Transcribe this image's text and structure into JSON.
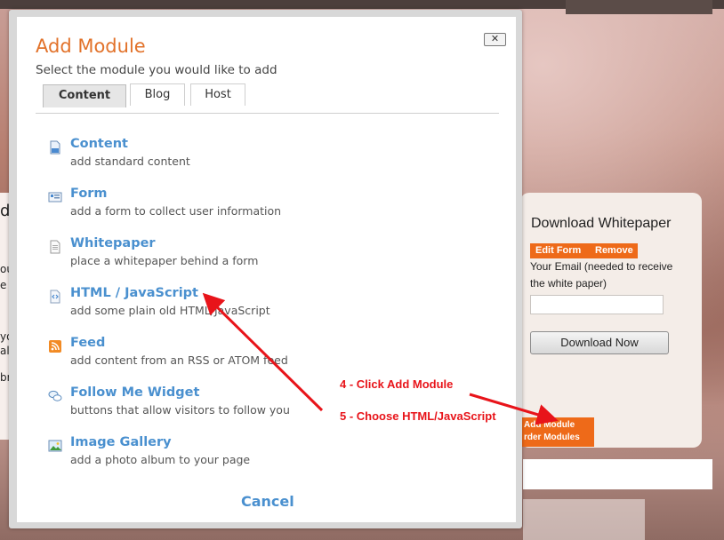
{
  "background": {
    "left_snippets": [
      "d",
      "ou",
      "e",
      "you",
      "allin",
      "br"
    ],
    "widget": {
      "title": "Download Whitepaper",
      "edit_form_label": "Edit Form",
      "remove_label": "Remove",
      "email_label": "Your Email (needed to receive the white paper)",
      "email_value": "",
      "download_button": "Download Now"
    },
    "add_module_button": {
      "line1": "Add Module",
      "line2": "rder Modules"
    },
    "colors": {
      "accent_orange": "#ee6a19"
    }
  },
  "modal": {
    "title": "Add Module",
    "subtitle": "Select the module you would like to add",
    "close_label": "✕",
    "tabs": [
      {
        "label": "Content",
        "active": true
      },
      {
        "label": "Blog",
        "active": false
      },
      {
        "label": "Host",
        "active": false
      }
    ],
    "items": [
      {
        "name": "Content",
        "desc": "add standard content",
        "icon": "document-icon"
      },
      {
        "name": "Form",
        "desc": "add a form to collect user information",
        "icon": "form-icon"
      },
      {
        "name": "Whitepaper",
        "desc": "place a whitepaper behind a form",
        "icon": "whitepaper-icon"
      },
      {
        "name": "HTML / JavaScript",
        "desc": "add some plain old HTML/JavaScript",
        "icon": "code-icon"
      },
      {
        "name": "Feed",
        "desc": "add content from an RSS or ATOM feed",
        "icon": "rss-icon"
      },
      {
        "name": "Follow Me Widget",
        "desc": "buttons that allow visitors to follow you",
        "icon": "speech-bubbles-icon"
      },
      {
        "name": "Image Gallery",
        "desc": "add a photo album to your page",
        "icon": "image-icon"
      }
    ],
    "cancel_label": "Cancel",
    "colors": {
      "title": "#e2722a",
      "link": "#4a90cf"
    }
  },
  "annotations": {
    "step4": "4 - Click Add Module",
    "step5": "5 - Choose HTML/JavaScript",
    "color": "#e8141a"
  }
}
